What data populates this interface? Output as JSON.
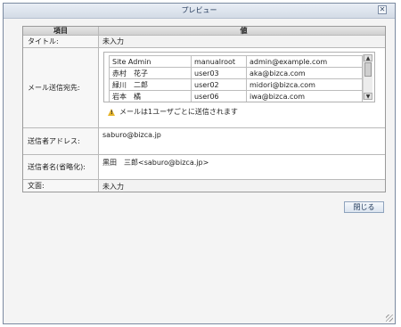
{
  "dialog": {
    "title": "プレビュー",
    "close_glyph": "✕"
  },
  "table": {
    "headers": {
      "item": "項目",
      "value": "値"
    },
    "rows": {
      "title": {
        "label": "タイトル:",
        "value": "未入力"
      },
      "recipients": {
        "label": "メール送信宛先:",
        "list": [
          {
            "name": "Site Admin",
            "user_id": "manualroot",
            "email": "admin@example.com"
          },
          {
            "name": "赤村　花子",
            "user_id": "user03",
            "email": "aka@bizca.com"
          },
          {
            "name": "緑川　二郎",
            "user_id": "user02",
            "email": "midori@bizca.com"
          },
          {
            "name": "岩本　橘",
            "user_id": "user06",
            "email": "iwa@bizca.com"
          }
        ],
        "notice": "メールは1ユーザごとに送信されます"
      },
      "sender_address": {
        "label": "送信者アドレス:",
        "value": "saburo@bizca.jp"
      },
      "sender_name": {
        "label": "送信者名(省略化):",
        "value": "黒田　三郎<saburo@bizca.jp>"
      },
      "body": {
        "label": "文面:",
        "value": "未入力"
      }
    }
  },
  "buttons": {
    "close": "閉じる"
  }
}
